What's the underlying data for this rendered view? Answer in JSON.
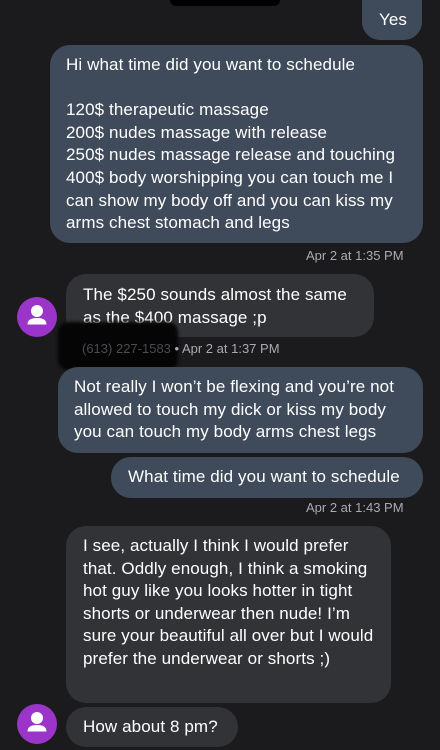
{
  "messages": [
    {
      "type": "sent",
      "text": "Yes"
    },
    {
      "type": "sent",
      "text": "Hi what time did you want to schedule\n\n120$ therapeutic massage\n200$ nudes massage with release\n250$ nudes massage release and touching\n400$ body worshipping you can touch me I can show my body off and you can kiss my arms chest stomach and legs",
      "time": "Apr 2 at 1:35 PM"
    },
    {
      "type": "received",
      "text": "The $250 sounds almost the same as the $400 massage ;p",
      "sender_partial": "(613) 227-1583",
      "time": "Apr 2 at 1:37 PM"
    },
    {
      "type": "sent",
      "text": "Not really I won’t be flexing and you’re not allowed to touch my dick or kiss my body you can touch my body arms chest legs"
    },
    {
      "type": "sent",
      "text": "What time did you want to schedule",
      "time": "Apr 2 at 1:43 PM"
    },
    {
      "type": "received",
      "text": "I see, actually I think I would prefer that. Oddly enough, I think a smoking hot guy like you looks hotter in tight shorts or underwear then nude! I’m sure your beautiful all over but I would prefer the underwear or shorts ;)"
    },
    {
      "type": "received",
      "text": "How about 8 pm?"
    }
  ],
  "colors": {
    "background": "#1b1b1e",
    "sent_bubble": "#3f4a5b",
    "received_bubble": "#323336",
    "avatar": "#9b35c9",
    "meta_text": "#a9abb0"
  },
  "icons": {
    "avatar": "person-icon"
  },
  "separator": " • "
}
